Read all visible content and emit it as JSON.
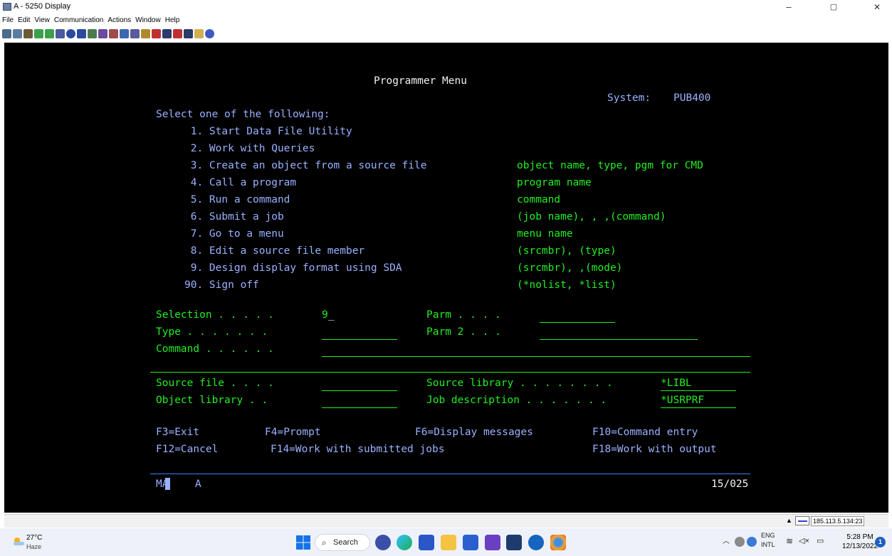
{
  "window": {
    "title": "A - 5250 Display",
    "minimize": "–",
    "restore": "▢",
    "close": "✕"
  },
  "menu": [
    "File",
    "Edit",
    "View",
    "Communication",
    "Actions",
    "Window",
    "Help"
  ],
  "toolbar_icons": [
    "print-icon",
    "print-screen-icon",
    "copy-icon",
    "send-file-icon",
    "receive-file-icon",
    "macro-icon",
    "record-icon",
    "play-icon",
    "stop-icon",
    "keyboard-icon",
    "color-icon",
    "display-icon",
    "popup-keypad-icon",
    "data-transfer-icon",
    "upload-icon",
    "download-icon",
    "upload2-icon",
    "download2-icon",
    "notes-icon",
    "help-icon"
  ],
  "screen": {
    "title": "Programmer Menu",
    "system_label": "System:",
    "system_value": "PUB400",
    "select_prompt": "Select one of the following:",
    "options": [
      {
        "label": " 1. Start Data File Utility",
        "hint": ""
      },
      {
        "label": " 2. Work with Queries",
        "hint": ""
      },
      {
        "label": " 3. Create an object from a source file",
        "hint": "object name, type, pgm for CMD"
      },
      {
        "label": " 4. Call a program",
        "hint": "program name"
      },
      {
        "label": " 5. Run a command",
        "hint": "command"
      },
      {
        "label": " 6. Submit a job",
        "hint": "(job name), , ,(command)"
      },
      {
        "label": " 7. Go to a menu",
        "hint": "menu name"
      },
      {
        "label": " 8. Edit a source file member",
        "hint": "(srcmbr), (type)"
      },
      {
        "label": " 9. Design display format using SDA",
        "hint": "(srcmbr), ,(mode)"
      },
      {
        "label": "90. Sign off",
        "hint": "(*nolist, *list)"
      }
    ],
    "fields": {
      "selection_label": "Selection . . . . .",
      "selection_value": "9",
      "cursor": "_",
      "parm_label": "Parm . . . .",
      "parm_value": "",
      "type_label": "Type . . . . . . .",
      "type_value": "",
      "parm2_label": "Parm 2 . . .",
      "parm2_value": "",
      "command_label": "Command . . . . . .",
      "command_value": "",
      "source_file_label": "Source file . . . .",
      "source_file_value": "",
      "source_library_label": "Source library . . . . . . . .",
      "source_library_value": "*LIBL",
      "object_library_label": "Object library . .",
      "object_library_value": "",
      "job_description_label": "Job description . . . . . . .",
      "job_description_value": "*USRPRF"
    },
    "fkeys_row1": [
      "F3=Exit",
      "F4=Prompt",
      "F6=Display messages",
      "F10=Command entry"
    ],
    "fkeys_row2": [
      "F12=Cancel",
      "F14=Work with submitted jobs",
      "F18=Work with output"
    ],
    "oia_left": "MA",
    "oia_mode": "A",
    "oia_position": "15/025"
  },
  "statusbar": {
    "arrow": "▲",
    "ip": "185.113.5.134:23"
  },
  "taskbar": {
    "temperature": "27°C",
    "condition": "Haze",
    "search": "Search",
    "lang1": "ENG",
    "lang2": "INTL",
    "time": "5:28 PM",
    "date": "12/13/2022",
    "notifications": "1"
  },
  "colors": {
    "terminal_bg": "#000000",
    "text_white": "#f2f2f2",
    "text_blue": "#9ab1ff",
    "text_green": "#22ee22",
    "separator": "#3f7cff"
  }
}
